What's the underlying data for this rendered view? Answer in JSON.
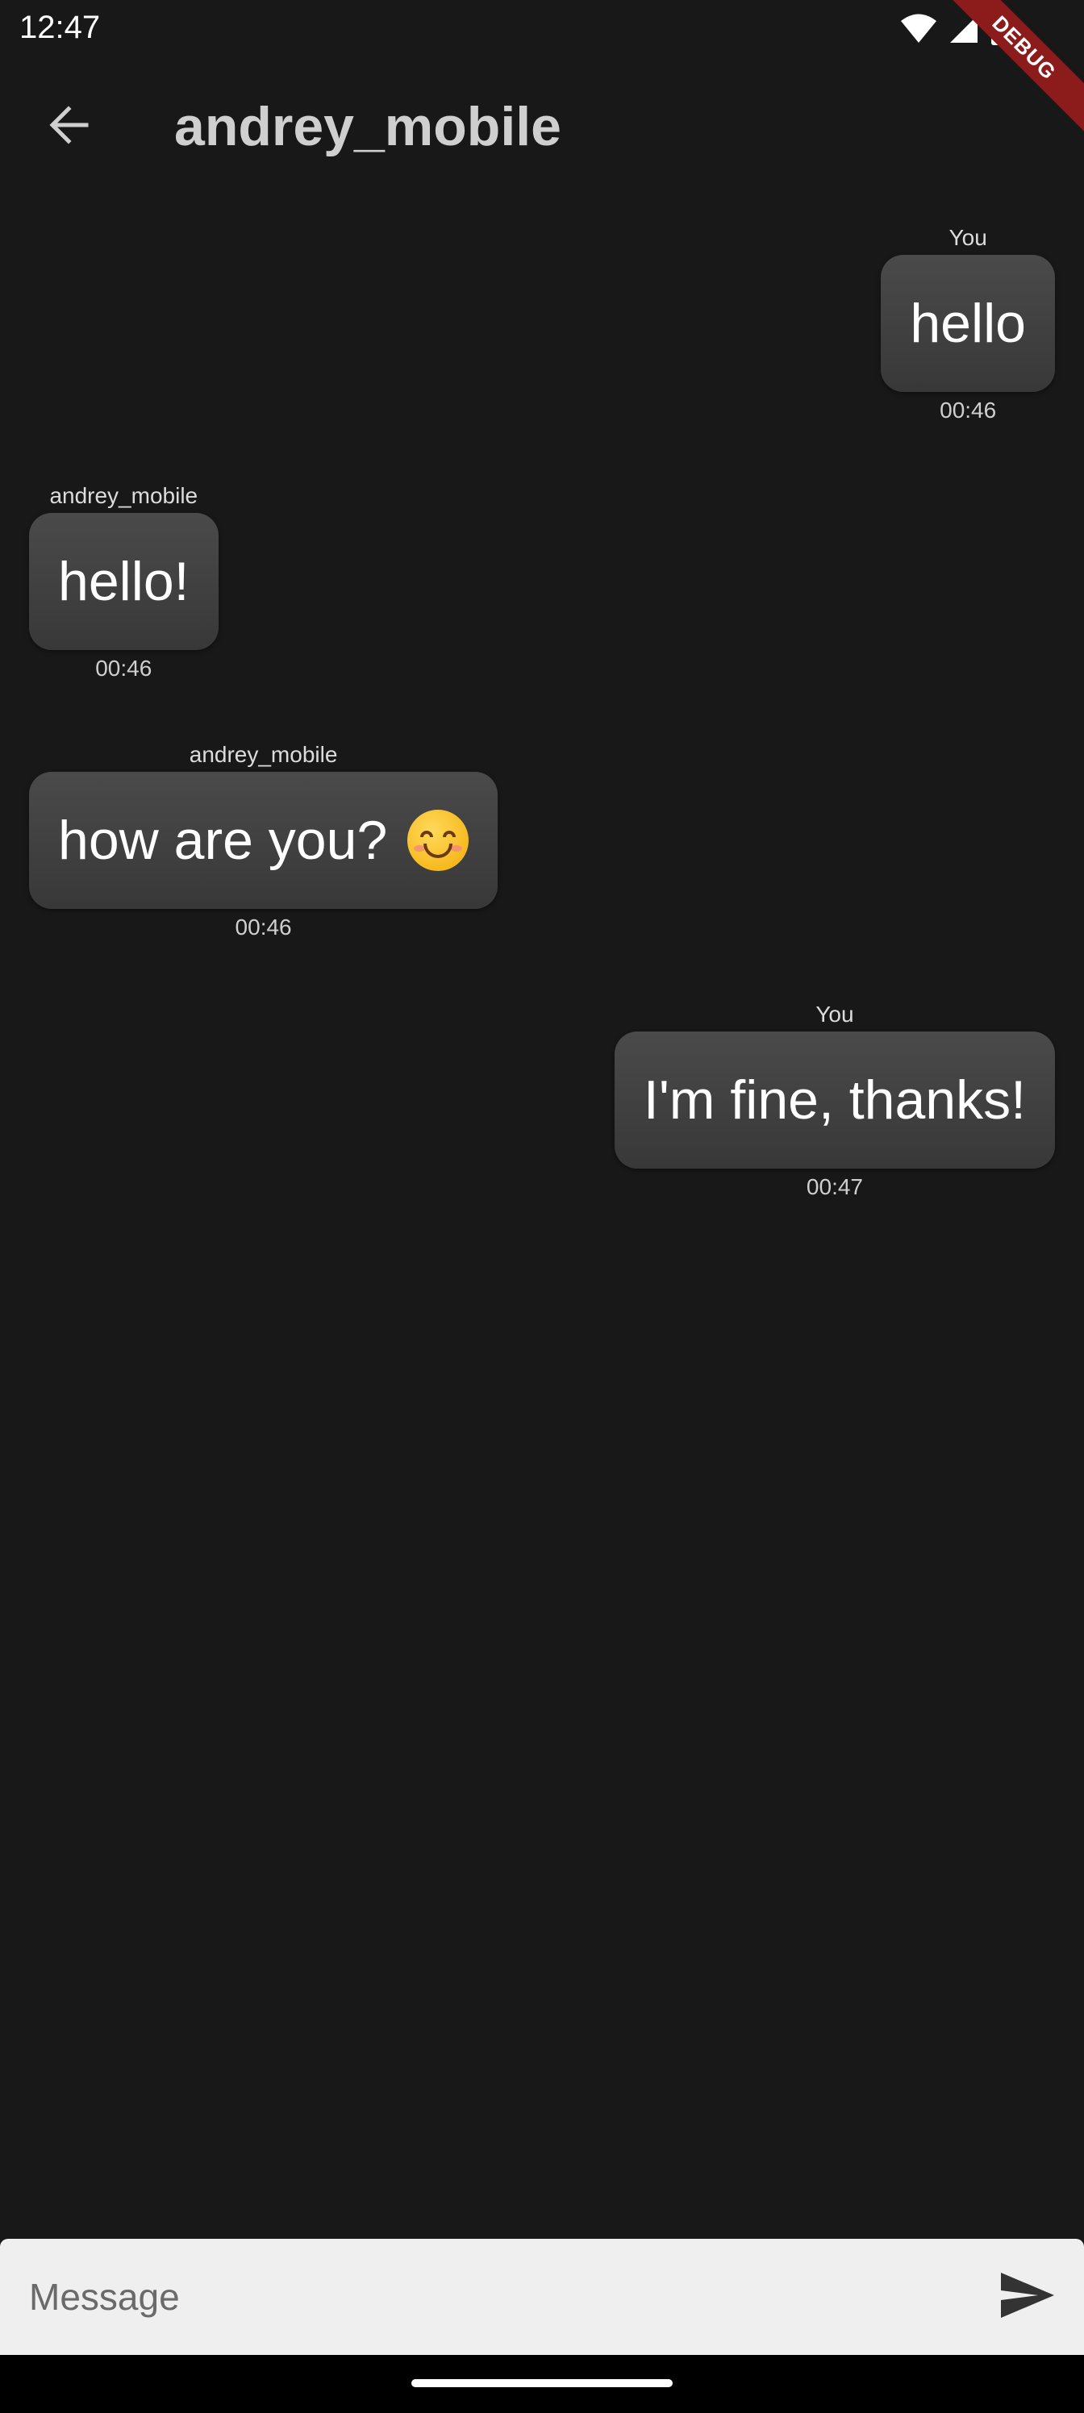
{
  "status_bar": {
    "time": "12:47",
    "icons": [
      "wifi-icon",
      "cell-signal-icon",
      "battery-icon"
    ]
  },
  "debug_banner": {
    "label": "DEBUG",
    "color": "#8c1b1b"
  },
  "app_bar": {
    "back_icon": "arrow-left-icon",
    "title": "andrey_mobile"
  },
  "messages": [
    {
      "sender": "You",
      "text": "hello",
      "time": "00:46",
      "outgoing": true
    },
    {
      "sender": "andrey_mobile",
      "text": "hello!",
      "time": "00:46",
      "outgoing": false
    },
    {
      "sender": "andrey_mobile",
      "text": "how are you? ",
      "emoji": "smiling-face-emoji",
      "time": "00:46",
      "outgoing": false
    },
    {
      "sender": "You",
      "text": "I'm fine, thanks!",
      "time": "00:47",
      "outgoing": true
    }
  ],
  "composer": {
    "placeholder": "Message",
    "value": "",
    "send_icon": "send-icon"
  },
  "colors": {
    "background": "#181818",
    "bubble": "#404040",
    "title": "#cfcfcf",
    "composer_bg": "#efefef"
  }
}
